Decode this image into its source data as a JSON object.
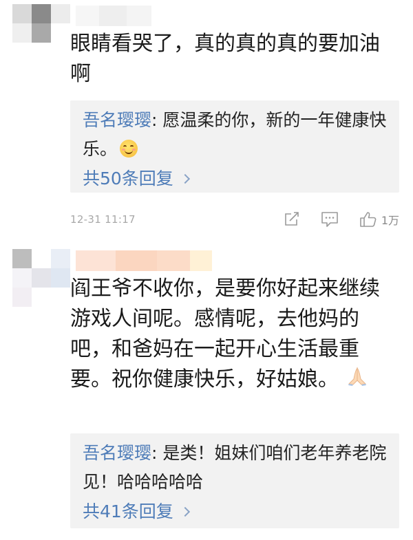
{
  "comments": [
    {
      "text": "眼睛看哭了，真的真的真的要加油啊",
      "reply": {
        "user": "吾名璎璎",
        "text": ": 愿温柔的你，新的一年健康快乐。",
        "emoji": "smile-emoji"
      },
      "replies_link": "共50条回复",
      "timestamp": "12-31 11:17",
      "likes": "1万"
    },
    {
      "text": "阎王爷不收你，是要你好起来继续游戏人间呢。感情呢，去他妈的吧，和爸妈在一起开心生活最重要。祝你健康快乐，好姑娘。",
      "emoji": "folded-hands-emoji",
      "reply": {
        "user": "吾名璎璎",
        "text": ": 是类！姐妹们咱们老年养老院见！哈哈哈哈哈"
      },
      "replies_link": "共41条回复"
    }
  ],
  "colors": {
    "link": "#4e7cb8",
    "reply_bg": "#f2f2f2",
    "meta": "#a8a8a8"
  }
}
